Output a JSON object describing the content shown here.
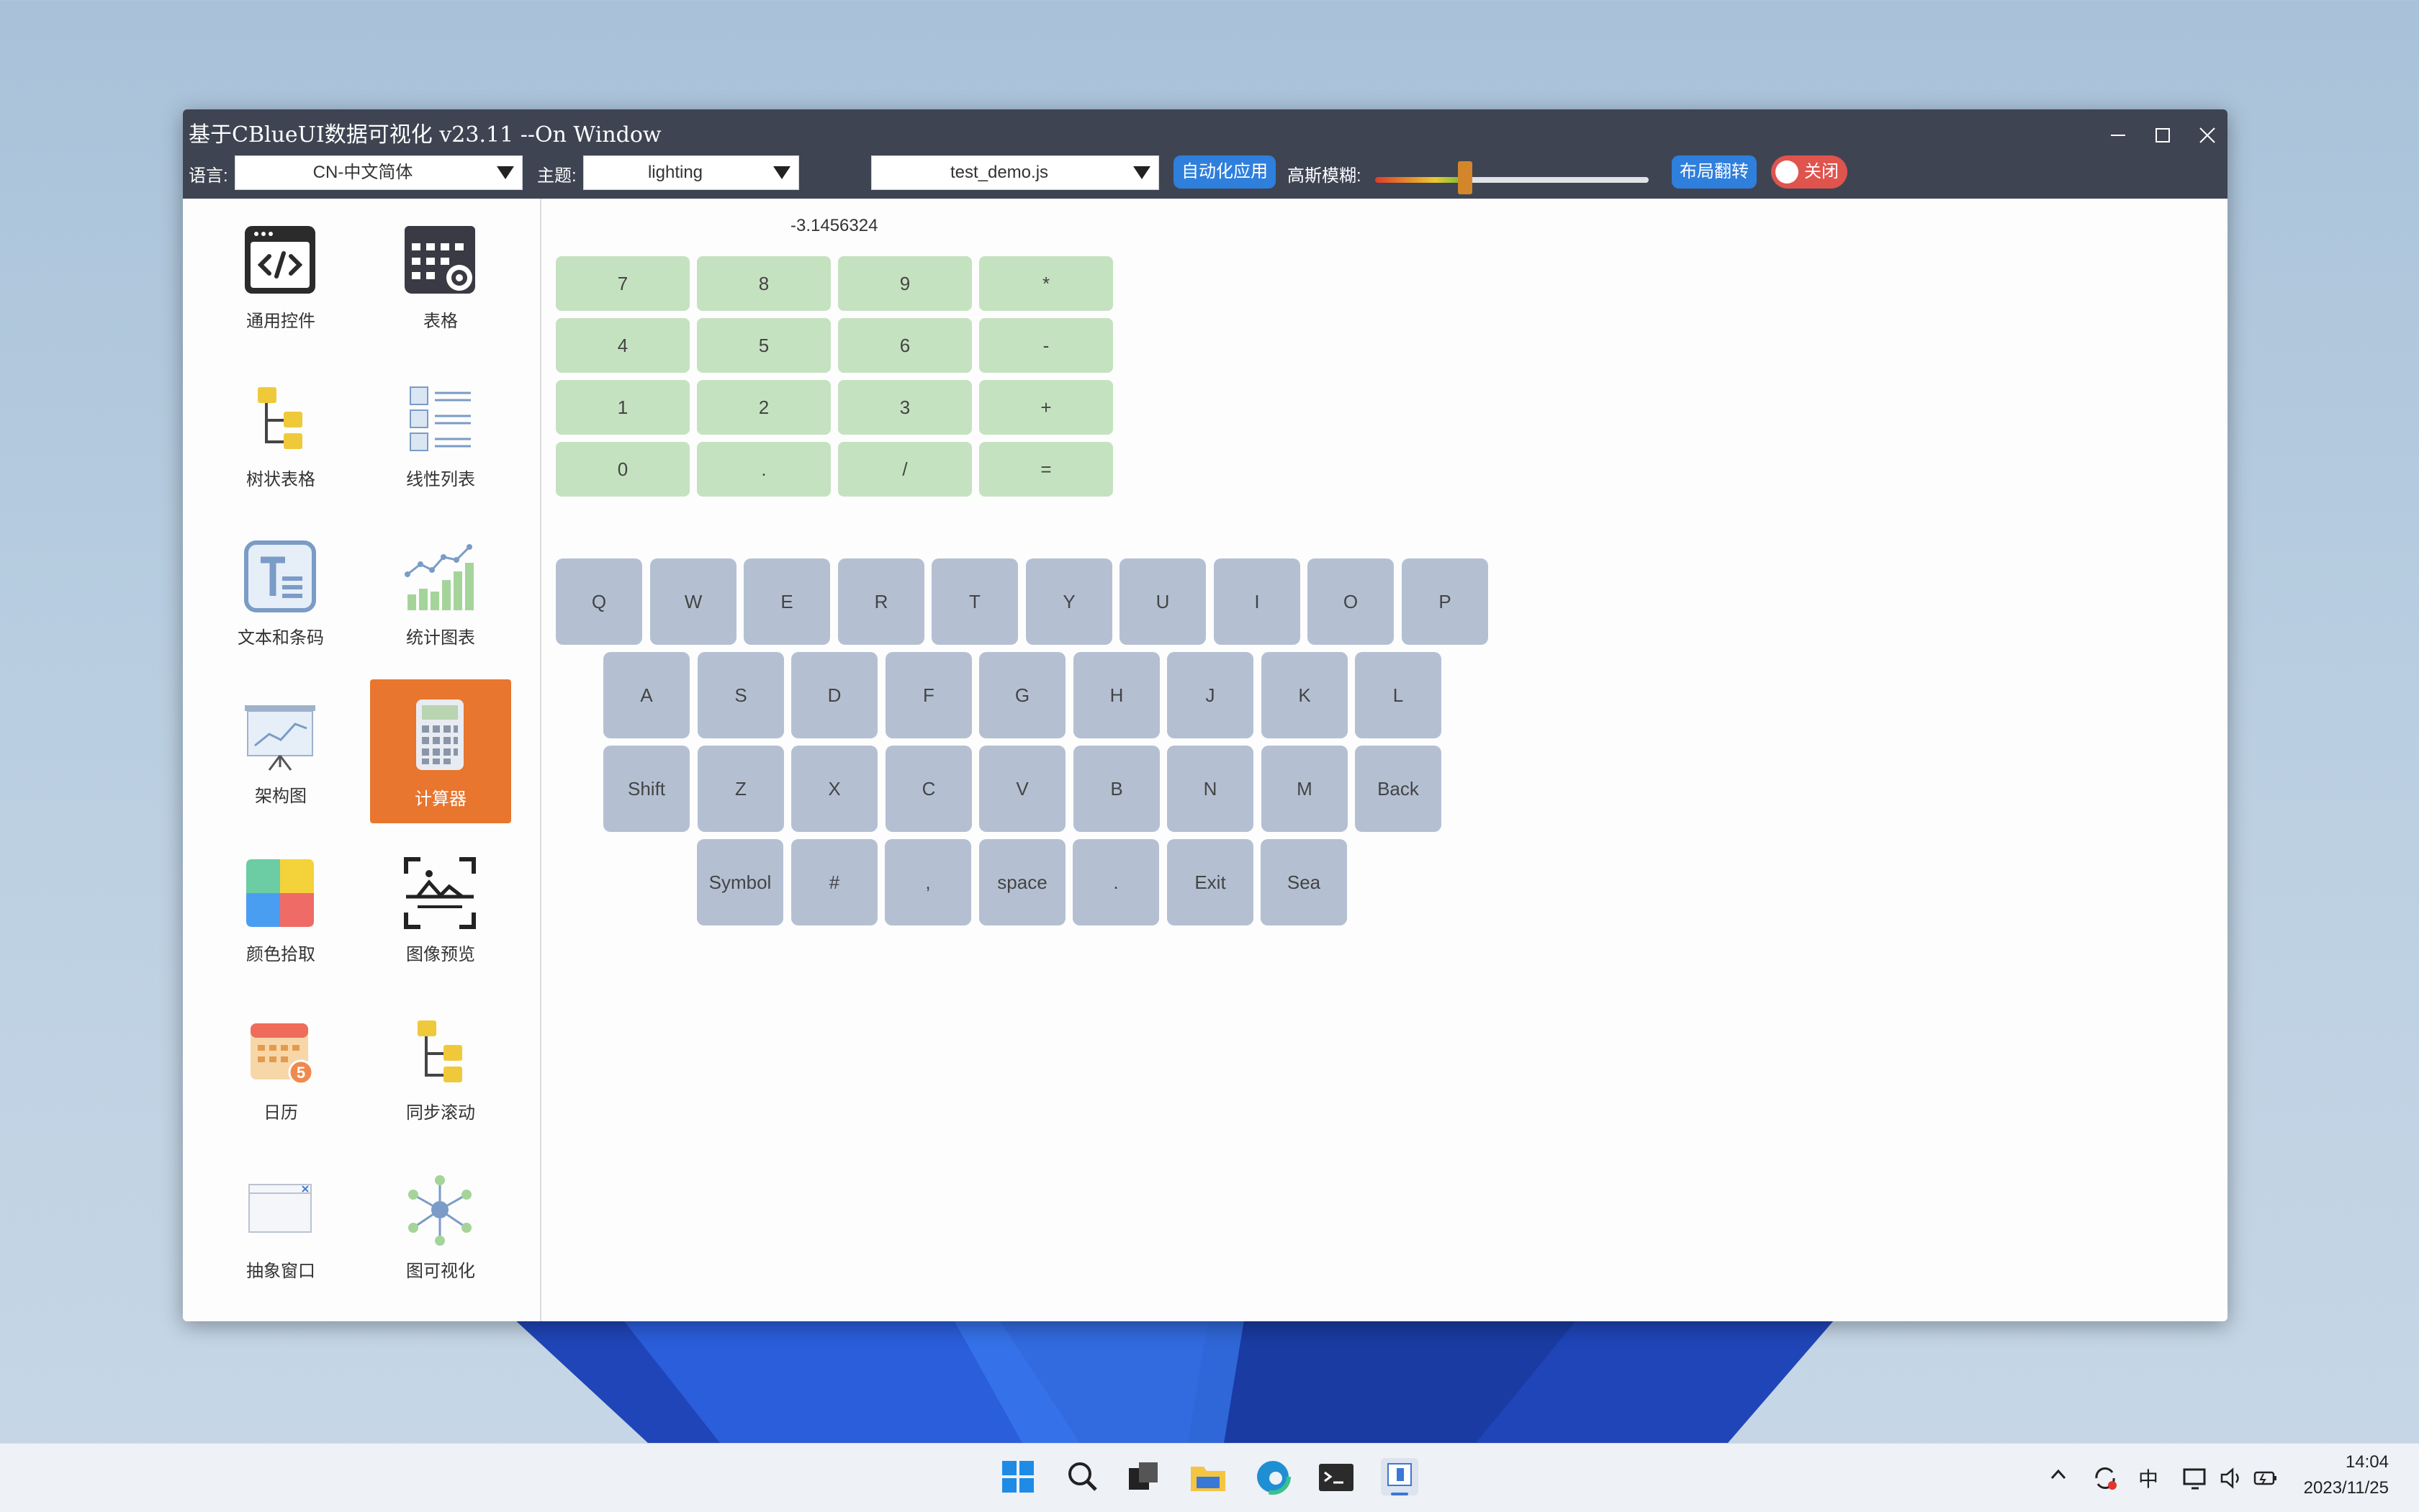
{
  "window": {
    "title": "基于CBlueUI数据可视化 v23.11 --On Window",
    "toolbar": {
      "language_label": "语言:",
      "language_value": "CN-中文简体",
      "theme_label": "主题:",
      "theme_value": "lighting",
      "script_value": "test_demo.js",
      "auto_apply_label": "自动化应用",
      "blur_label": "高斯模糊:",
      "blur_level": 0.33,
      "layout_flip_label": "布局翻转",
      "toggle_label": "关闭"
    }
  },
  "sidebar": {
    "items": [
      {
        "label": "通用控件",
        "icon": "code-window-icon"
      },
      {
        "label": "表格",
        "icon": "table-settings-icon"
      },
      {
        "label": "树状表格",
        "icon": "tree-table-icon"
      },
      {
        "label": "线性列表",
        "icon": "linear-list-icon"
      },
      {
        "label": "文本和条码",
        "icon": "text-barcode-icon"
      },
      {
        "label": "统计图表",
        "icon": "bar-line-chart-icon"
      },
      {
        "label": "架构图",
        "icon": "presentation-board-icon"
      },
      {
        "label": "计算器",
        "icon": "calculator-icon",
        "active": true
      },
      {
        "label": "颜色拾取",
        "icon": "color-palette-icon"
      },
      {
        "label": "图像预览",
        "icon": "image-preview-icon"
      },
      {
        "label": "日历",
        "icon": "calendar-icon",
        "badge": "5"
      },
      {
        "label": "同步滚动",
        "icon": "sync-scroll-icon"
      },
      {
        "label": "抽象窗口",
        "icon": "abstract-window-icon"
      },
      {
        "label": "图可视化",
        "icon": "graph-visual-icon"
      }
    ]
  },
  "calculator": {
    "display": "-3.1456324",
    "keys": [
      [
        "7",
        "8",
        "9",
        "*"
      ],
      [
        "4",
        "5",
        "6",
        "-"
      ],
      [
        "1",
        "2",
        "3",
        "+"
      ],
      [
        "0",
        ".",
        "/",
        "="
      ]
    ]
  },
  "keyboard": {
    "rows": [
      [
        "Q",
        "W",
        "E",
        "R",
        "T",
        "Y",
        "U",
        "I",
        "O",
        "P"
      ],
      [
        "A",
        "S",
        "D",
        "F",
        "G",
        "H",
        "J",
        "K",
        "L"
      ],
      [
        "Shift",
        "Z",
        "X",
        "C",
        "V",
        "B",
        "N",
        "M",
        "Back"
      ],
      [
        "Symbol",
        "#",
        ",",
        "space",
        ".",
        "Exit",
        "Sea"
      ]
    ]
  },
  "taskbar": {
    "apps": [
      "windows-start-icon",
      "search-icon",
      "task-view-icon",
      "file-explorer-icon",
      "edge-browser-icon",
      "terminal-icon",
      "active-app-icon"
    ],
    "tray": {
      "ime": "中",
      "time": "14:04",
      "date": "2023/11/25"
    }
  }
}
